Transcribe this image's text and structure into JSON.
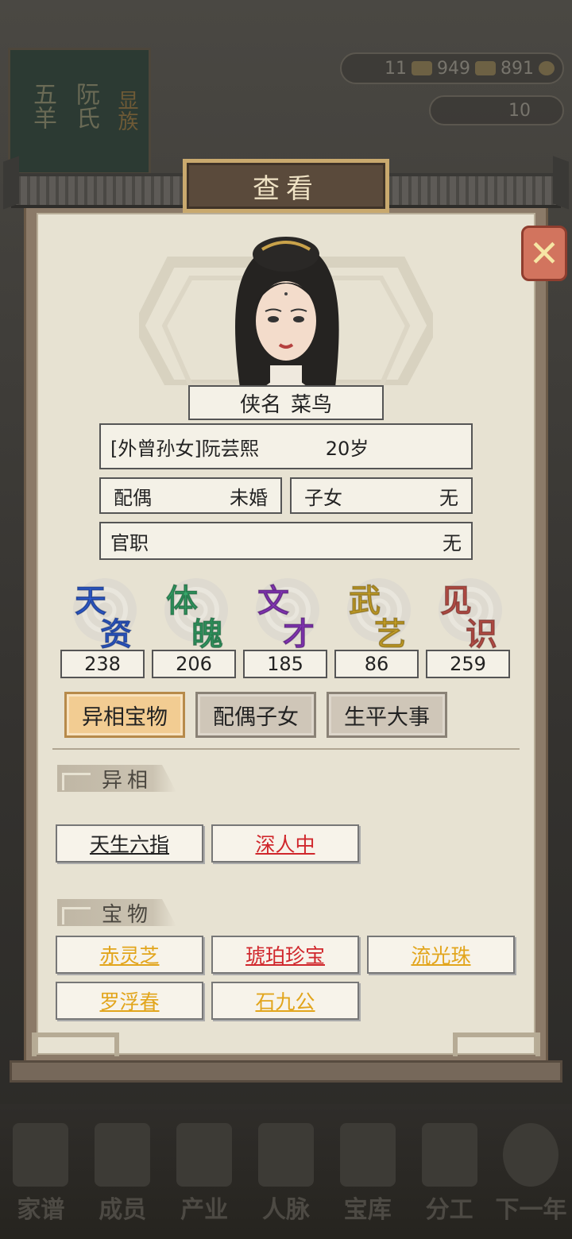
{
  "dialog": {
    "title": "查看"
  },
  "background": {
    "banner_chars": [
      "五羊",
      "阮氏",
      "显族"
    ],
    "resources": [
      "11",
      "949",
      "891"
    ],
    "gold": "10",
    "nav": [
      "家谱",
      "成员",
      "产业",
      "人脉",
      "宝库",
      "分工",
      "下一年"
    ]
  },
  "character": {
    "title_label": "侠名",
    "title_value": "菜鸟",
    "name_line": "[外曾孙女]阮芸熙",
    "age": "20岁",
    "spouse_label": "配偶",
    "spouse_value": "未婚",
    "children_label": "子女",
    "children_value": "无",
    "office_label": "官职",
    "office_value": "无"
  },
  "stats": [
    {
      "name": "天资",
      "value": "238",
      "color": "#2f5fd8"
    },
    {
      "name": "体魄",
      "value": "206",
      "color": "#36a76a"
    },
    {
      "name": "文才",
      "value": "185",
      "color": "#8d38c2"
    },
    {
      "name": "武艺",
      "value": "86",
      "color": "#d6ad2b"
    },
    {
      "name": "见识",
      "value": "259",
      "color": "#c8554c"
    }
  ],
  "tabs": [
    {
      "label": "异相宝物",
      "active": true
    },
    {
      "label": "配偶子女",
      "active": false
    },
    {
      "label": "生平大事",
      "active": false
    }
  ],
  "sections": {
    "traits": {
      "header": "异相",
      "items": [
        {
          "label": "天生六指",
          "color": "black"
        },
        {
          "label": "深人中",
          "color": "red"
        }
      ]
    },
    "treasures": {
      "header": "宝物",
      "items": [
        {
          "label": "赤灵芝",
          "color": "gold"
        },
        {
          "label": "琥珀珍宝",
          "color": "red"
        },
        {
          "label": "流光珠",
          "color": "gold"
        },
        {
          "label": "罗浮春",
          "color": "gold"
        },
        {
          "label": "石九公",
          "color": "gold"
        }
      ]
    }
  }
}
